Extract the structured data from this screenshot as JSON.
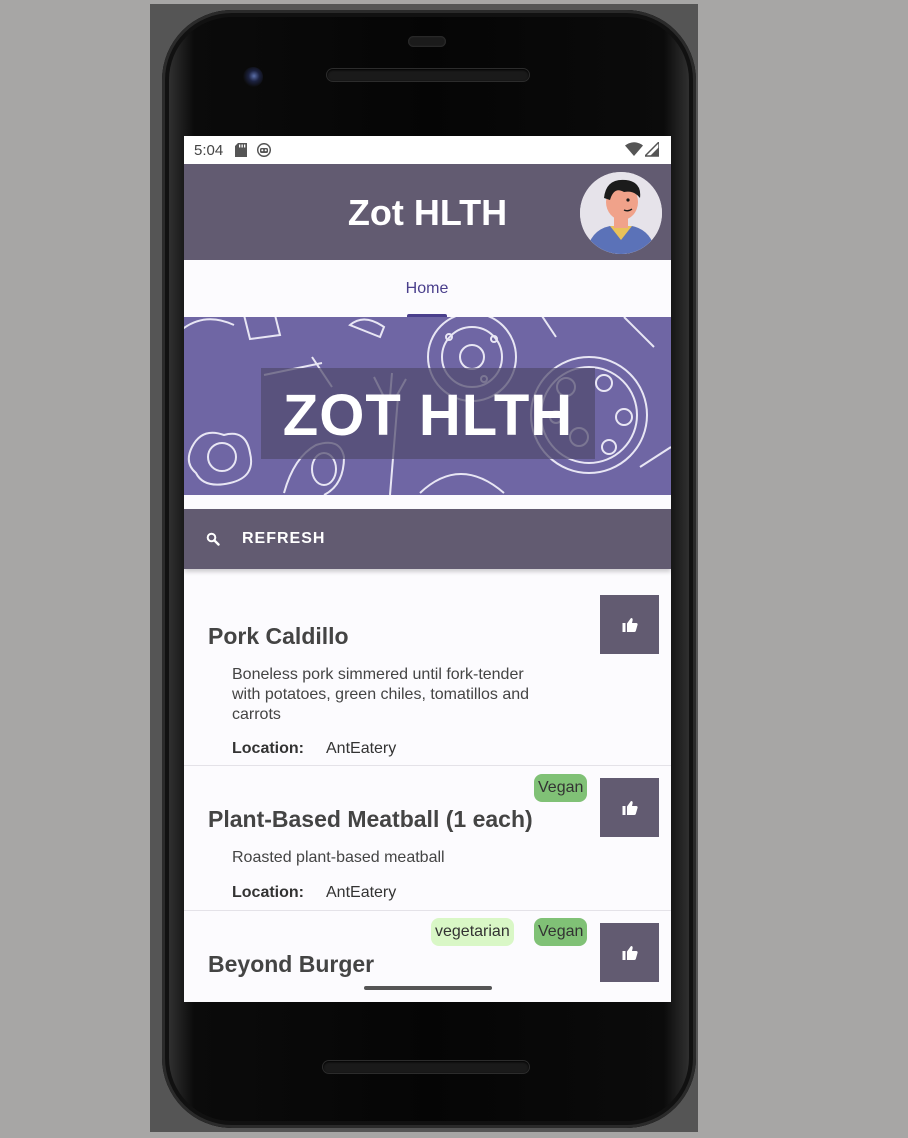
{
  "status_bar": {
    "time": "5:04"
  },
  "app_bar": {
    "title": "Zot HLTH"
  },
  "tabs": [
    {
      "label": "Home",
      "selected": true
    }
  ],
  "banner": {
    "text": "ZOT HLTH"
  },
  "actions": {
    "refresh_label": "REFRESH"
  },
  "menu_items": [
    {
      "name": "Pork Caldillo",
      "description": "Boneless pork simmered until fork-tender with potatoes, green chiles, tomatillos and carrots",
      "location_label": "Location:",
      "location": "AntEatery",
      "tags": []
    },
    {
      "name": "Plant-Based Meatball (1  each)",
      "description": "Roasted plant-based meatball",
      "location_label": "Location:",
      "location": "AntEatery",
      "tags": [
        "Vegan"
      ]
    },
    {
      "name": "Beyond Burger",
      "tags": [
        "vegetarian",
        "Vegan"
      ]
    }
  ],
  "colors": {
    "primary": "#625b71",
    "banner": "#6f66a4",
    "tab_accent": "#4a3f8c",
    "vegan_badge": "#80c176",
    "vegetarian_badge": "#d9f7c6"
  },
  "icons": {
    "status": [
      "sd-card-icon",
      "robot-icon",
      "wifi-icon",
      "signal-icon"
    ],
    "refresh": "search-icon",
    "like": "thumb-up-icon"
  }
}
